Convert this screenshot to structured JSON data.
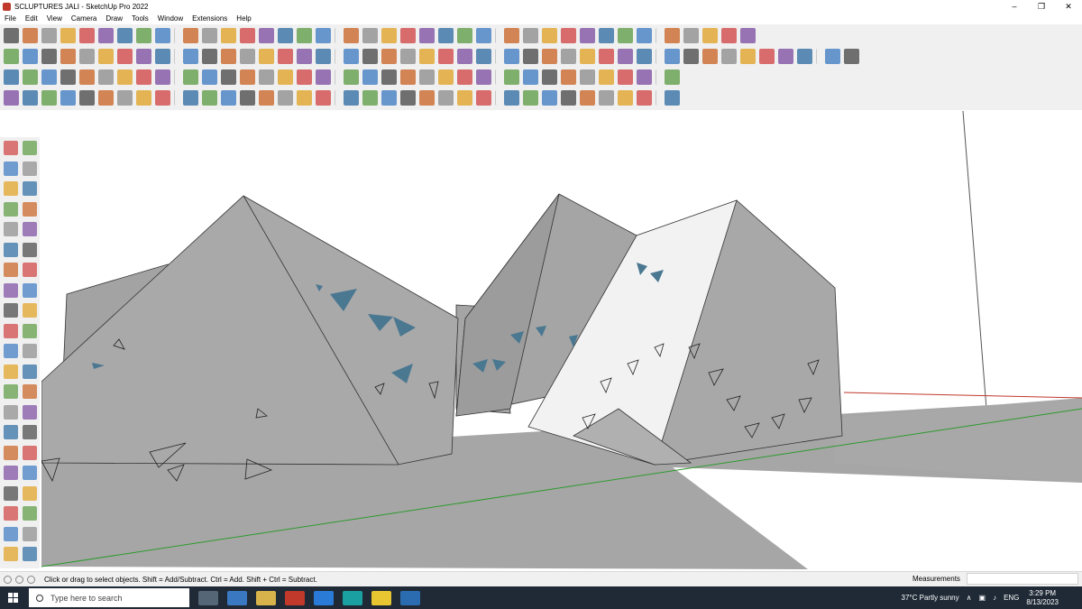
{
  "window": {
    "title": "SCLUPTURES JALI - SketchUp Pro 2022",
    "minimize": "–",
    "maximize": "❐",
    "close": "✕"
  },
  "menu": [
    "File",
    "Edit",
    "View",
    "Camera",
    "Draw",
    "Tools",
    "Window",
    "Extensions",
    "Help"
  ],
  "status": {
    "text": "Click or drag to select objects. Shift = Add/Subtract. Ctrl = Add. Shift + Ctrl = Subtract.",
    "measurements_label": "Measurements",
    "measurements_value": ""
  },
  "taskbar": {
    "search_placeholder": "Type here to search",
    "weather": "37°C  Partly sunny",
    "language": "ENG",
    "time": "3:29 PM",
    "date": "8/13/2023"
  },
  "colors": {
    "sculpture_gray": "#a9a9a9",
    "sculpture_light": "#f2f2f2",
    "opening_blue": "#4a7891",
    "ground_gray": "#a6a6a6",
    "green_axis": "#2e9a2e",
    "red_axis": "#c0392b",
    "taskbar": "#1f2a36"
  }
}
